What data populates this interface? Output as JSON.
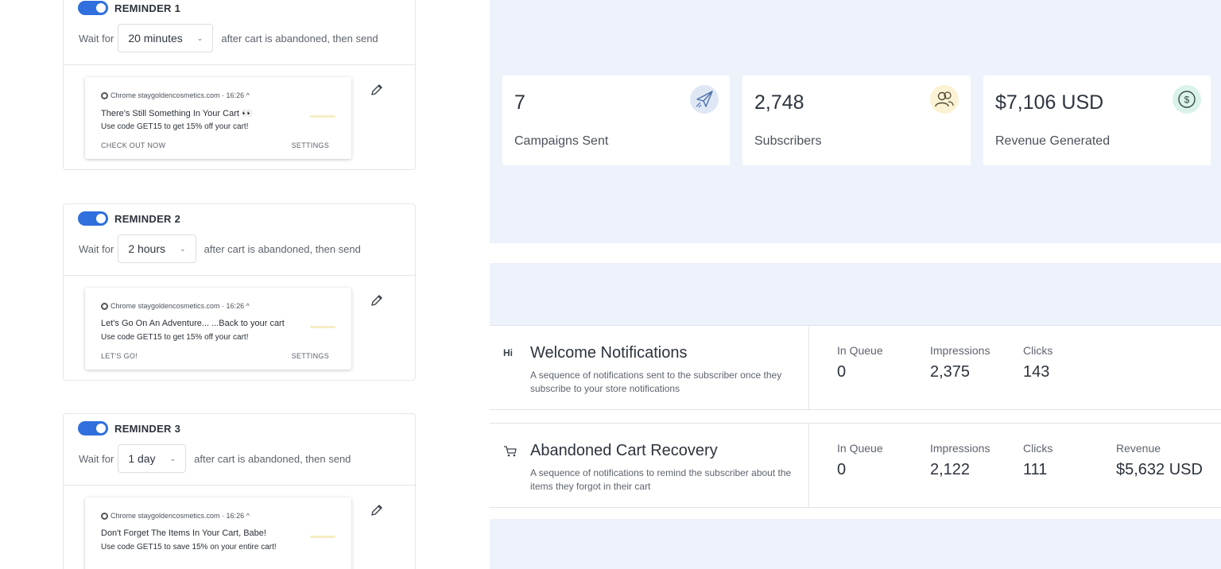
{
  "reminders": [
    {
      "title": "REMINDER 1",
      "wait_label": "Wait for",
      "delay": "20 minutes",
      "after_text": "after cart is abandoned, then send",
      "notification": {
        "source": "Chrome  staygoldencosmetics.com · 16:26 ^",
        "title": "There's Still Something In Your Cart 👀",
        "text": "Use code GET15 to get 15% off your cart!",
        "cta": "CHECK OUT NOW",
        "settings": "SETTINGS"
      }
    },
    {
      "title": "REMINDER 2",
      "wait_label": "Wait for",
      "delay": "2 hours",
      "after_text": "after cart is abandoned, then send",
      "notification": {
        "source": "Chrome  staygoldencosmetics.com · 16:26 ^",
        "title": "Let's Go On An Adventure... ...Back to your cart",
        "text": "Use code GET15 to get 15% off your cart!",
        "cta": "LET'S GO!",
        "settings": "SETTINGS"
      }
    },
    {
      "title": "REMINDER 3",
      "wait_label": "Wait for",
      "delay": "1 day",
      "after_text": "after cart is abandoned, then send",
      "notification": {
        "source": "Chrome  staygoldencosmetics.com · 16:26 ^",
        "title": "Don't Forget The Items In Your Cart, Babe!",
        "text": "Use code GET15 to save 15% on your entire cart!",
        "cta": "",
        "settings": ""
      }
    }
  ],
  "stats": [
    {
      "value": "7",
      "label": "Campaigns Sent",
      "icon": "paper-plane-icon",
      "icon_bg": "#dfe7f5"
    },
    {
      "value": "2,748",
      "label": "Subscribers",
      "icon": "users-icon",
      "icon_bg": "#fbf2d3"
    },
    {
      "value": "$7,106 USD",
      "label": "Revenue Generated",
      "icon": "dollar-icon",
      "icon_bg": "#d9f3ea"
    }
  ],
  "flows": [
    {
      "icon_text": "Hi",
      "title": "Welcome Notifications",
      "description": "A sequence of notifications sent to the subscriber once they subscribe to your store notifications",
      "metrics": [
        {
          "label": "In Queue",
          "value": "0"
        },
        {
          "label": "Impressions",
          "value": "2,375"
        },
        {
          "label": "Clicks",
          "value": "143"
        }
      ]
    },
    {
      "icon_text": "",
      "icon": "cart-icon",
      "title": "Abandoned Cart Recovery",
      "description": "A sequence of notifications to remind the subscriber about the items they forgot in their cart",
      "metrics": [
        {
          "label": "In Queue",
          "value": "0"
        },
        {
          "label": "Impressions",
          "value": "2,122"
        },
        {
          "label": "Clicks",
          "value": "111"
        },
        {
          "label": "Revenue",
          "value": "$5,632 USD"
        }
      ]
    }
  ],
  "colors": {
    "accent": "#2f6fde",
    "panel_bg": "#edf2fb"
  }
}
